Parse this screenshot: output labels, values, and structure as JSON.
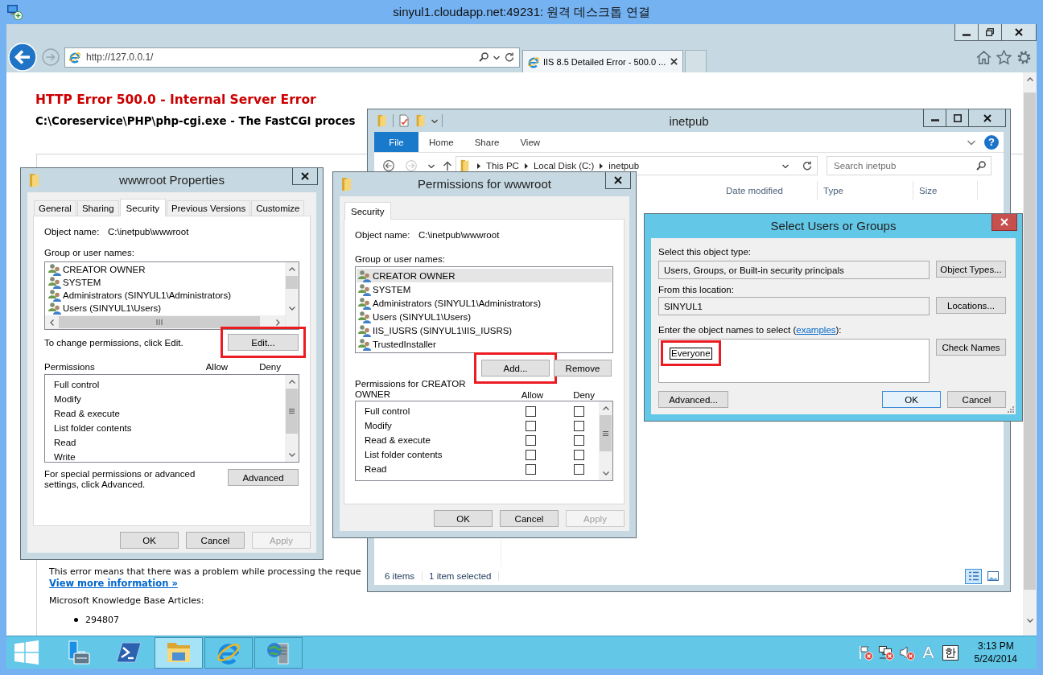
{
  "remote_window": {
    "title": "sinyul1.cloudapp.net:49231: 원격 데스크톱 연결"
  },
  "browser": {
    "address": "http://127.0.0.1/",
    "tabs": [
      {
        "label": "IIS 8.5 Detailed Error - 500.0 ...",
        "selected": true
      }
    ],
    "page": {
      "heading": "HTTP Error 500.0 - Internal Server Error",
      "subheading": "C:\\Coreservice\\PHP\\php-cgi.exe - The FastCGI proces",
      "description": "This error means that there was a problem while processing the reque",
      "link": "View more information »",
      "kb_heading": "Microsoft Knowledge Base Articles:",
      "kb_articles": [
        "294807"
      ]
    }
  },
  "explorer": {
    "active": false,
    "title": "inetpub",
    "ribbon_tabs": [
      {
        "label": "File",
        "selected": true
      },
      {
        "label": "Home",
        "selected": false
      },
      {
        "label": "Share",
        "selected": false
      },
      {
        "label": "View",
        "selected": false
      }
    ],
    "help": "?",
    "breadcrumb": [
      "This PC",
      "Local Disk (C:)",
      "inetpub"
    ],
    "search": {
      "placeholder": "Search inetpub"
    },
    "columns": [
      "Date modified",
      "Type",
      "Size"
    ],
    "status": [
      "6 items",
      "1 item selected"
    ],
    "views": [
      {
        "kind": "details",
        "selected": true
      },
      {
        "kind": "preview",
        "selected": false
      }
    ]
  },
  "properties_dialog": {
    "active": false,
    "title": "wwwroot Properties",
    "tabs": [
      {
        "label": "General",
        "selected": false
      },
      {
        "label": "Sharing",
        "selected": false
      },
      {
        "label": "Security",
        "selected": true
      },
      {
        "label": "Previous Versions",
        "selected": false
      },
      {
        "label": "Customize",
        "selected": false
      }
    ],
    "object_label": "Object name:",
    "object_name": "C:\\inetpub\\wwwroot",
    "group_label": "Group or user names:",
    "users": [
      {
        "name": "CREATOR OWNER",
        "selected": false
      },
      {
        "name": "SYSTEM",
        "selected": false
      },
      {
        "name": "Administrators (SINYUL1\\Administrators)",
        "selected": false
      },
      {
        "name": "Users (SINYUL1\\Users)",
        "selected": false
      }
    ],
    "edit_hint": "To change permissions, click Edit.",
    "edit_button": {
      "label": "Edit...",
      "highlighted": true
    },
    "permissions_label": "Permissions",
    "allow_label": "Allow",
    "deny_label": "Deny",
    "permissions": [
      "Full control",
      "Modify",
      "Read & execute",
      "List folder contents",
      "Read",
      "Write"
    ],
    "advanced_hint": "For special permissions or advanced settings, click Advanced.",
    "advanced_button": "Advanced",
    "buttons": [
      {
        "label": "OK",
        "disabled": false
      },
      {
        "label": "Cancel",
        "disabled": false
      },
      {
        "label": "Apply",
        "disabled": true
      }
    ]
  },
  "permissions_dialog": {
    "active": false,
    "title": "Permissions for wwwroot",
    "tabs": [
      {
        "label": "Security",
        "selected": true
      }
    ],
    "object_label": "Object name:",
    "object_name": "C:\\inetpub\\wwwroot",
    "group_label": "Group or user names:",
    "users": [
      {
        "name": "CREATOR OWNER",
        "selected": true
      },
      {
        "name": "SYSTEM",
        "selected": false
      },
      {
        "name": "Administrators (SINYUL1\\Administrators)",
        "selected": false
      },
      {
        "name": "Users (SINYUL1\\Users)",
        "selected": false
      },
      {
        "name": "IIS_IUSRS (SINYUL1\\IIS_IUSRS)",
        "selected": false
      },
      {
        "name": "TrustedInstaller",
        "selected": false
      }
    ],
    "add_button": {
      "label": "Add...",
      "highlighted": true
    },
    "remove_button": {
      "label": "Remove",
      "highlighted": false
    },
    "permissions_label": "Permissions for CREATOR OWNER",
    "allow_label": "Allow",
    "deny_label": "Deny",
    "permissions": [
      {
        "name": "Full control",
        "allow": false,
        "deny": false
      },
      {
        "name": "Modify",
        "allow": false,
        "deny": false
      },
      {
        "name": "Read & execute",
        "allow": false,
        "deny": false
      },
      {
        "name": "List folder contents",
        "allow": false,
        "deny": false
      },
      {
        "name": "Read",
        "allow": false,
        "deny": false
      }
    ],
    "buttons": [
      {
        "label": "OK",
        "disabled": false
      },
      {
        "label": "Cancel",
        "disabled": false
      },
      {
        "label": "Apply",
        "disabled": true
      }
    ]
  },
  "select_dialog": {
    "active": true,
    "title": "Select Users or Groups",
    "object_type_label": "Select this object type:",
    "object_type": "Users, Groups, or Built-in security principals",
    "object_types_button": "Object Types...",
    "location_label": "From this location:",
    "location": "SINYUL1",
    "locations_button": "Locations...",
    "names_label": "Enter the object names to select (",
    "examples_link": "examples",
    "names_label_end": "):",
    "names": {
      "value": "Everyone",
      "highlighted": true
    },
    "check_names_button": "Check Names",
    "buttons": [
      {
        "label": "Advanced...",
        "default": false
      },
      {
        "label": "OK",
        "default": true
      },
      {
        "label": "Cancel",
        "default": false
      }
    ]
  },
  "taskbar": {
    "apps": [
      {
        "kind": "server",
        "running": false,
        "selected": false
      },
      {
        "kind": "shell",
        "running": false,
        "selected": false
      },
      {
        "kind": "folder",
        "running": true,
        "selected": true
      },
      {
        "kind": "browser",
        "running": true,
        "selected": false
      },
      {
        "kind": "tools",
        "running": true,
        "selected": false
      }
    ],
    "tray": {
      "action_alert": true,
      "network_error": true,
      "muted": true,
      "input_mode": "A",
      "language": "한",
      "time": "3:13 PM",
      "date": "5/24/2014"
    }
  }
}
